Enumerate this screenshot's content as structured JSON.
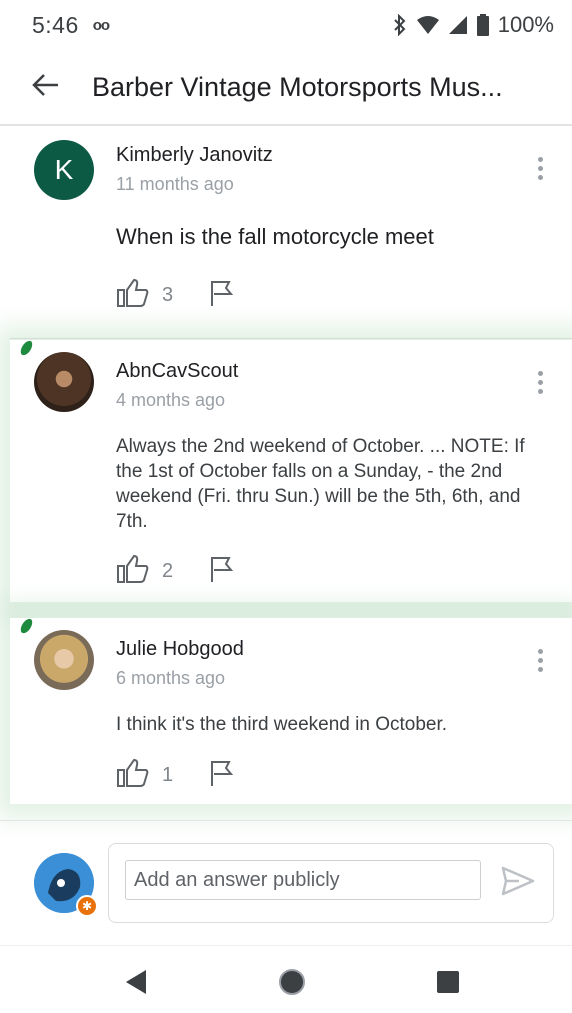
{
  "status_bar": {
    "time": "5:46",
    "voicemail": "oo",
    "battery": "100%"
  },
  "app_bar": {
    "title": "Barber Vintage Motorsports Mus..."
  },
  "question": {
    "avatar_letter": "K",
    "author": "Kimberly Janovitz",
    "time_ago": "11 months ago",
    "text": "When is the fall motorcycle meet",
    "likes": "3"
  },
  "answers": [
    {
      "author": "AbnCavScout",
      "time_ago": "4 months ago",
      "text": "Always the 2nd weekend of October. ... NOTE: If the 1st of October falls on a Sunday, - the 2nd weekend (Fri. thru Sun.) will be the 5th, 6th, and 7th.",
      "likes": "2"
    },
    {
      "author": "Julie Hobgood",
      "time_ago": "6 months ago",
      "text": "I think it's the third weekend in October.",
      "likes": "1"
    }
  ],
  "compose": {
    "placeholder": "Add an answer publicly"
  },
  "colors": {
    "avatar_k": "#0d5a44",
    "highlight": "#a0d4ab",
    "marker": "#1e8a3e",
    "muted": "#9aa0a6"
  }
}
